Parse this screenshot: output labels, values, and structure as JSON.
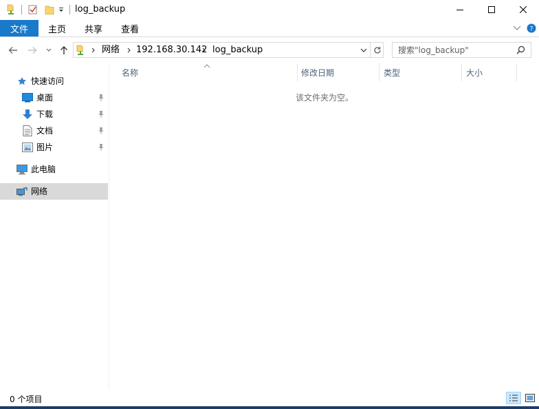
{
  "titlebar": {
    "title": "log_backup",
    "buttons": [
      "minimize",
      "maximize",
      "close"
    ]
  },
  "ribbon": {
    "tabs": [
      {
        "label": "文件",
        "active": true
      },
      {
        "label": "主页"
      },
      {
        "label": "共享"
      },
      {
        "label": "查看"
      }
    ]
  },
  "address": {
    "crumbs": [
      "网络",
      "192.168.30.142",
      "log_backup"
    ]
  },
  "search": {
    "placeholder": "搜索\"log_backup\""
  },
  "sidebar": {
    "quick_access": {
      "label": "快速访问",
      "icon": "star-icon"
    },
    "items": [
      {
        "label": "桌面",
        "icon": "desktop-icon",
        "pinned": true
      },
      {
        "label": "下载",
        "icon": "download-icon",
        "pinned": true
      },
      {
        "label": "文档",
        "icon": "document-icon",
        "pinned": true
      },
      {
        "label": "图片",
        "icon": "pictures-icon",
        "pinned": true
      }
    ],
    "this_pc": {
      "label": "此电脑",
      "icon": "computer-icon"
    },
    "network": {
      "label": "网络",
      "icon": "network-icon",
      "selected": true
    }
  },
  "columns": [
    {
      "label": "名称",
      "sorted": true
    },
    {
      "label": "修改日期"
    },
    {
      "label": "类型"
    },
    {
      "label": "大小"
    }
  ],
  "content": {
    "empty_message": "该文件夹为空。"
  },
  "status": {
    "item_count": "0 个项目"
  },
  "colors": {
    "accent": "#1979ca",
    "selection": "#d9d9d9",
    "column_text": "#4c607a"
  }
}
